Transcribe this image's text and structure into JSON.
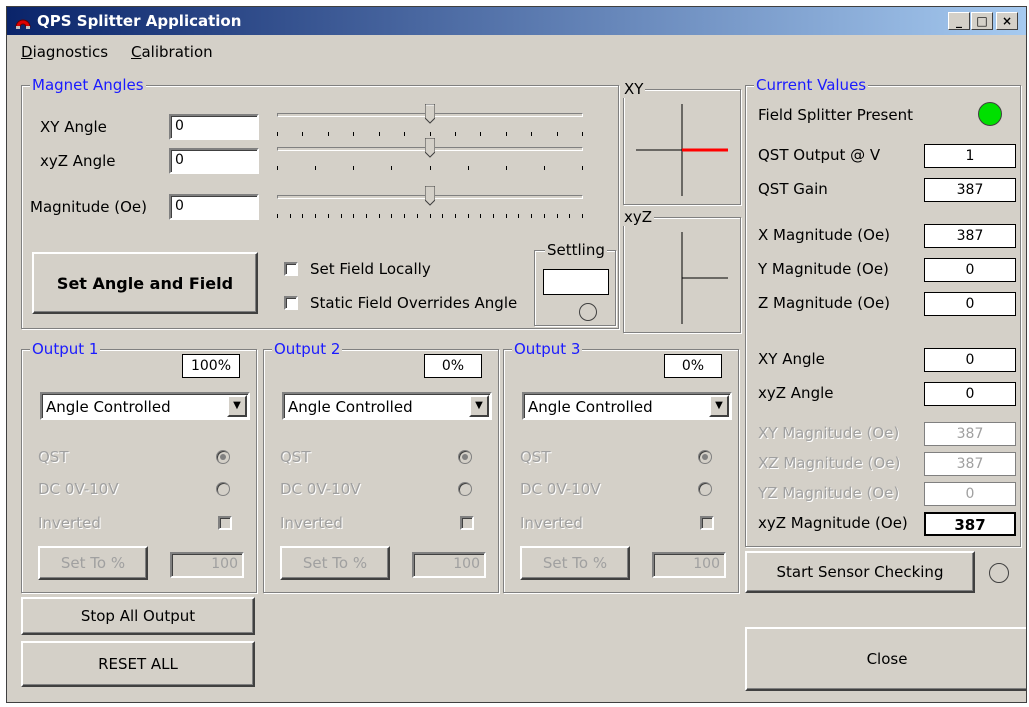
{
  "window": {
    "title": "QPS Splitter Application",
    "controls": {
      "minimize": "_",
      "maximize": "□",
      "close": "×"
    }
  },
  "menu": {
    "diagnostics": "Diagnostics",
    "calibration": "Calibration"
  },
  "magnet_angles": {
    "legend": "Magnet Angles",
    "xy_label": "XY Angle",
    "xy_value": "0",
    "xyz_label": "xyZ Angle",
    "xyz_value": "0",
    "magnitude_label": "Magnitude (Oe)",
    "magnitude_value": "0",
    "slider_levels": [
      0.5,
      0.5,
      0.5
    ],
    "set_button": "Set Angle and Field",
    "set_field_locally": "Set Field Locally",
    "static_override": "Static Field Overrides Angle",
    "settling_legend": "Settling",
    "settling_value": ""
  },
  "xy_plot": {
    "legend": "XY",
    "line_color": "#ff0000"
  },
  "xyz_plot": {
    "legend": "xyZ"
  },
  "outputs": [
    {
      "legend": "Output 1",
      "percent": "100%",
      "mode": "Angle Controlled",
      "qst": "QST",
      "dc": "DC 0V-10V",
      "inverted": "Inverted",
      "set_to": "Set To %",
      "value": "100"
    },
    {
      "legend": "Output 2",
      "percent": "0%",
      "mode": "Angle Controlled",
      "qst": "QST",
      "dc": "DC 0V-10V",
      "inverted": "Inverted",
      "set_to": "Set To %",
      "value": "100"
    },
    {
      "legend": "Output 3",
      "percent": "0%",
      "mode": "Angle Controlled",
      "qst": "QST",
      "dc": "DC 0V-10V",
      "inverted": "Inverted",
      "set_to": "Set To %",
      "value": "100"
    }
  ],
  "current_values": {
    "legend": "Current Values",
    "splitter_present": "Field Splitter Present",
    "splitter_led_color": "#00e000",
    "rows": [
      {
        "label": "QST Output @ V",
        "value": "1"
      },
      {
        "label": "QST Gain",
        "value": "387"
      },
      {
        "label": "X Magnitude (Oe)",
        "value": "387"
      },
      {
        "label": "Y Magnitude (Oe)",
        "value": "0"
      },
      {
        "label": "Z Magnitude (Oe)",
        "value": "0"
      },
      {
        "label": "XY Angle",
        "value": "0"
      },
      {
        "label": "xyZ Angle",
        "value": "0"
      },
      {
        "label": "XY Magnitude (Oe)",
        "value": "387"
      },
      {
        "label": "XZ Magnitude (Oe)",
        "value": "387"
      },
      {
        "label": "YZ Magnitude (Oe)",
        "value": "0"
      },
      {
        "label": "xyZ Magnitude (Oe)",
        "value": "387"
      }
    ]
  },
  "buttons": {
    "start_sensor": "Start Sensor Checking",
    "stop_all": "Stop All Output",
    "reset_all": "RESET ALL",
    "close": "Close"
  }
}
